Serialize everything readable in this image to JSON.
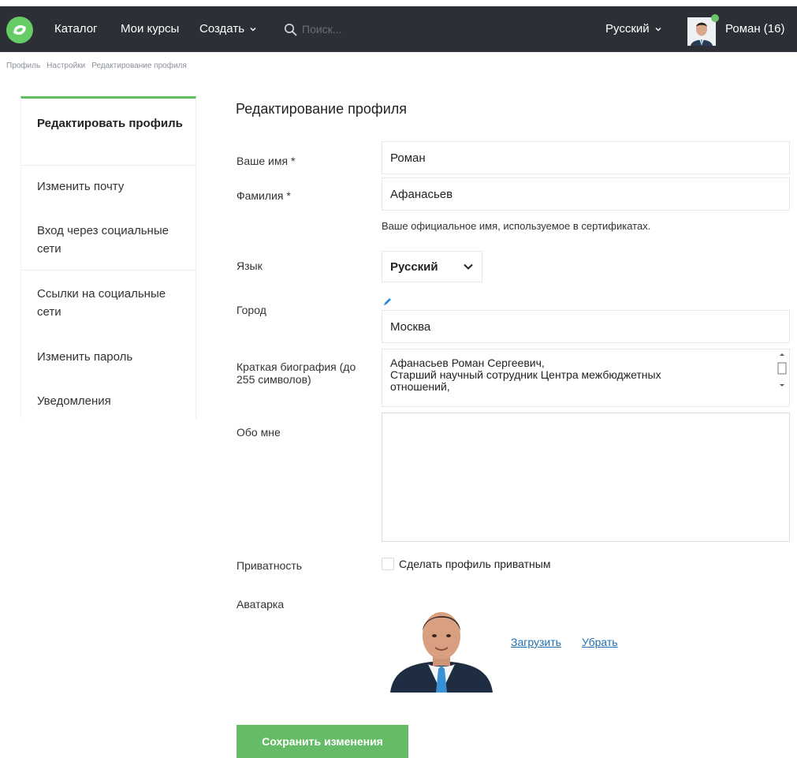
{
  "nav": {
    "catalog": "Каталог",
    "my_courses": "Мои курсы",
    "create": "Создать",
    "search_placeholder": "Поиск...",
    "language": "Русский",
    "user": "Роман (16)"
  },
  "breadcrumb": [
    "Профиль",
    "Настройки",
    "Редактирование профиля"
  ],
  "sidebar": {
    "items": [
      {
        "label": "Редактировать профиль",
        "active": true
      },
      {
        "label": "Изменить почту"
      },
      {
        "label": "Вход через социальные сети"
      },
      {
        "label": "Ссылки на социальные сети"
      },
      {
        "label": "Изменить пароль"
      },
      {
        "label": "Уведомления"
      }
    ]
  },
  "form": {
    "title": "Редактирование профиля",
    "first_name_label": "Ваше имя *",
    "first_name": "Роман",
    "last_name_label": "Фамилия *",
    "last_name": "Афанасьев",
    "name_hint": "Ваше официальное имя, используемое в сертификатах.",
    "language_label": "Язык",
    "language_value": "Русский",
    "city_label": "Город",
    "city": "Москва",
    "bio_label": "Краткая биография (до 255 символов)",
    "bio_lines": [
      "Афанасьев Роман Сергеевич,",
      "Старший научный сотрудник Центра межбюджетных",
      "отношений,"
    ],
    "about_label": "Обо мне",
    "privacy_label": "Приватность",
    "privacy_checkbox": "Сделать профиль приватным",
    "avatar_label": "Аватарка",
    "upload": "Загрузить",
    "remove": "Убрать",
    "save": "Сохранить изменения"
  },
  "colors": {
    "topbar": "#2c2f35",
    "accent": "#66bb66",
    "link": "#1f6fb2"
  }
}
